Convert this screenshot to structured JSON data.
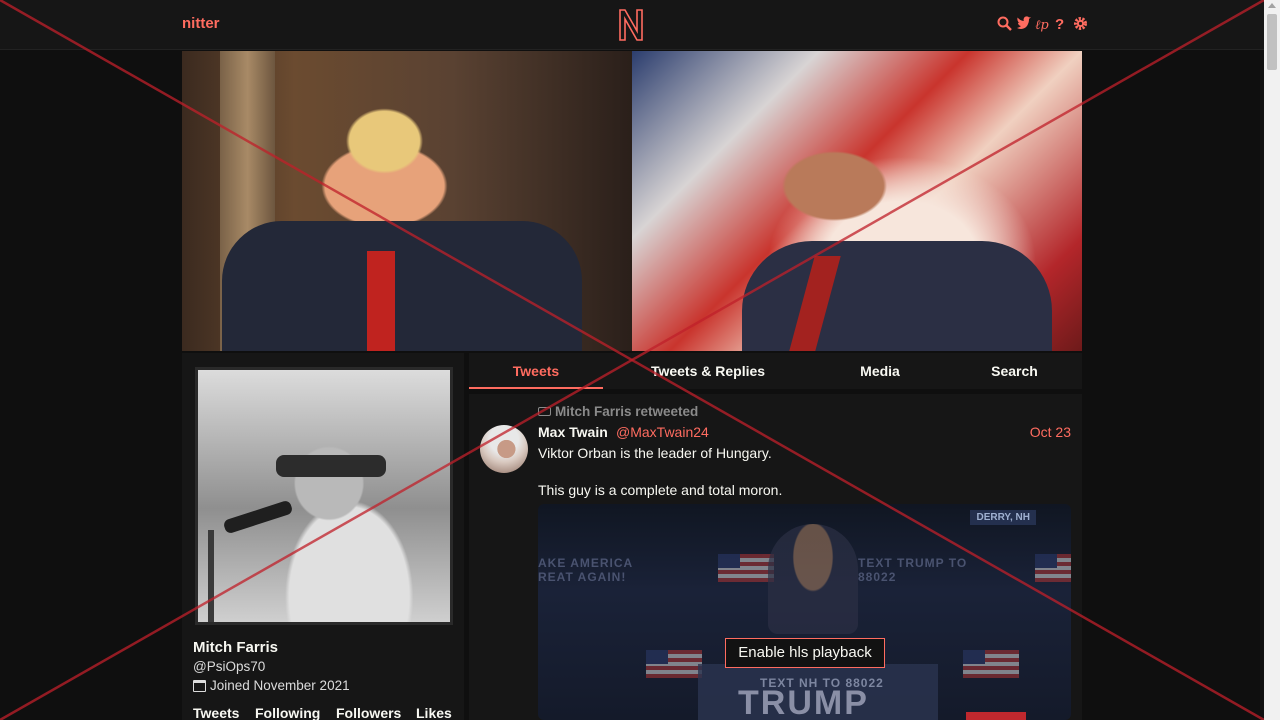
{
  "navbar": {
    "logo_text": "nitter",
    "logo_icon": "N-logo-icon",
    "icons": [
      "search-icon",
      "twitter-icon",
      "rss-icon",
      "help-icon",
      "settings-icon"
    ],
    "accent_color": "#ff6c60"
  },
  "profile": {
    "fullname": "Mitch Farris",
    "username": "@PsiOps70",
    "joined": "Joined November 2021",
    "stats": [
      "Tweets",
      "Following",
      "Followers",
      "Likes"
    ]
  },
  "tabs": [
    {
      "label": "Tweets",
      "active": true
    },
    {
      "label": "Tweets & Replies",
      "active": false
    },
    {
      "label": "Media",
      "active": false
    },
    {
      "label": "Search",
      "active": false
    }
  ],
  "timeline": {
    "tweet": {
      "retweet_header": "Mitch Farris retweeted",
      "fullname": "Max Twain",
      "username": "@MaxTwain24",
      "date": "Oct 23",
      "text_line1": "Viktor Orban is the leader of Hungary.",
      "text_line2": "This guy is a complete and total moron.",
      "video": {
        "derry_label": "DERRY, NH",
        "sign_left": "AKE AMERICA REAT AGAIN!",
        "sign_right": "TEXT TRUMP TO 88022",
        "podium_text_small": "TEXT NH TO 88022",
        "podium_text_big": "TRUMP",
        "hls_button": "Enable hls playback"
      }
    }
  }
}
